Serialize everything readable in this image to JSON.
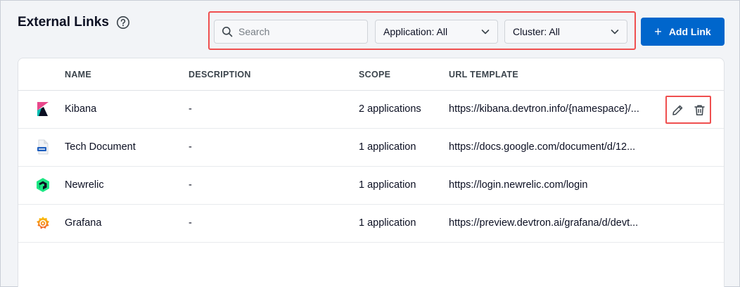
{
  "header": {
    "title": "External Links"
  },
  "filters": {
    "search_placeholder": "Search",
    "application_label": "Application: All",
    "cluster_label": "Cluster: All"
  },
  "toolbar": {
    "add_label": "Add Link"
  },
  "table": {
    "columns": [
      "NAME",
      "DESCRIPTION",
      "SCOPE",
      "URL TEMPLATE"
    ],
    "rows": [
      {
        "icon": "kibana-icon",
        "name": "Kibana",
        "description": "-",
        "scope": "2 applications",
        "url": "https://kibana.devtron.info/{namespace}/..."
      },
      {
        "icon": "document-icon",
        "name": "Tech Document",
        "description": "-",
        "scope": "1 application",
        "url": "https://docs.google.com/document/d/12..."
      },
      {
        "icon": "newrelic-icon",
        "name": "Newrelic",
        "description": "-",
        "scope": "1 application",
        "url": "https://login.newrelic.com/login"
      },
      {
        "icon": "grafana-icon",
        "name": "Grafana",
        "description": "-",
        "scope": "1 application",
        "url": "https://preview.devtron.ai/grafana/d/devt..."
      }
    ]
  },
  "colors": {
    "accent": "#0066cc",
    "highlight": "#ef4f4f"
  }
}
